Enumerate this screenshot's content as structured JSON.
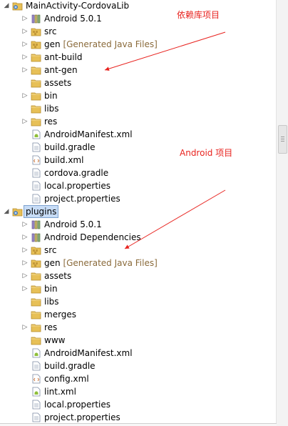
{
  "projects": [
    {
      "name": "MainActivity-CordovaLib",
      "selected": false,
      "children": [
        {
          "label": "Android 5.0.1",
          "icon": "library-icon",
          "expandable": true
        },
        {
          "label": "src",
          "icon": "source-folder-icon",
          "expandable": true
        },
        {
          "label": "gen",
          "decoration": "[Generated Java Files]",
          "icon": "source-folder-icon",
          "expandable": true
        },
        {
          "label": "ant-build",
          "icon": "folder-icon",
          "expandable": true
        },
        {
          "label": "ant-gen",
          "icon": "folder-icon",
          "expandable": true
        },
        {
          "label": "assets",
          "icon": "folder-icon",
          "expandable": false
        },
        {
          "label": "bin",
          "icon": "folder-icon",
          "expandable": true
        },
        {
          "label": "libs",
          "icon": "folder-icon",
          "expandable": false
        },
        {
          "label": "res",
          "icon": "folder-icon",
          "expandable": true
        },
        {
          "label": "AndroidManifest.xml",
          "icon": "android-manifest-icon",
          "expandable": false
        },
        {
          "label": "build.gradle",
          "icon": "file-icon",
          "expandable": false
        },
        {
          "label": "build.xml",
          "icon": "xml-file-icon",
          "expandable": false
        },
        {
          "label": "cordova.gradle",
          "icon": "file-icon",
          "expandable": false
        },
        {
          "label": "local.properties",
          "icon": "file-icon",
          "expandable": false
        },
        {
          "label": "project.properties",
          "icon": "file-icon",
          "expandable": false
        }
      ]
    },
    {
      "name": "plugins",
      "selected": true,
      "children": [
        {
          "label": "Android 5.0.1",
          "icon": "library-icon",
          "expandable": true
        },
        {
          "label": "Android Dependencies",
          "icon": "library-icon",
          "expandable": true
        },
        {
          "label": "src",
          "icon": "source-folder-icon",
          "expandable": true
        },
        {
          "label": "gen",
          "decoration": "[Generated Java Files]",
          "icon": "source-folder-icon",
          "expandable": true
        },
        {
          "label": "assets",
          "icon": "folder-icon",
          "expandable": true
        },
        {
          "label": "bin",
          "icon": "folder-icon",
          "expandable": true
        },
        {
          "label": "libs",
          "icon": "folder-icon",
          "expandable": false
        },
        {
          "label": "merges",
          "icon": "folder-icon",
          "expandable": false
        },
        {
          "label": "res",
          "icon": "folder-icon",
          "expandable": true
        },
        {
          "label": "www",
          "icon": "folder-icon",
          "expandable": false
        },
        {
          "label": "AndroidManifest.xml",
          "icon": "android-manifest-icon",
          "expandable": false
        },
        {
          "label": "build.gradle",
          "icon": "file-icon",
          "expandable": false
        },
        {
          "label": "config.xml",
          "icon": "xml-file-icon",
          "expandable": false
        },
        {
          "label": "lint.xml",
          "icon": "android-manifest-icon",
          "expandable": false
        },
        {
          "label": "local.properties",
          "icon": "file-icon",
          "expandable": false
        },
        {
          "label": "project.properties",
          "icon": "file-icon",
          "expandable": false
        }
      ]
    }
  ],
  "annotations": {
    "library_project": "依赖库项目",
    "android_project": "Android 项目"
  },
  "colors": {
    "annotation": "#e8231f",
    "selection": "#c7dcf6",
    "folder": "#e7c057",
    "library": "#8b7ab8",
    "decoration": "#8a6a3a"
  }
}
